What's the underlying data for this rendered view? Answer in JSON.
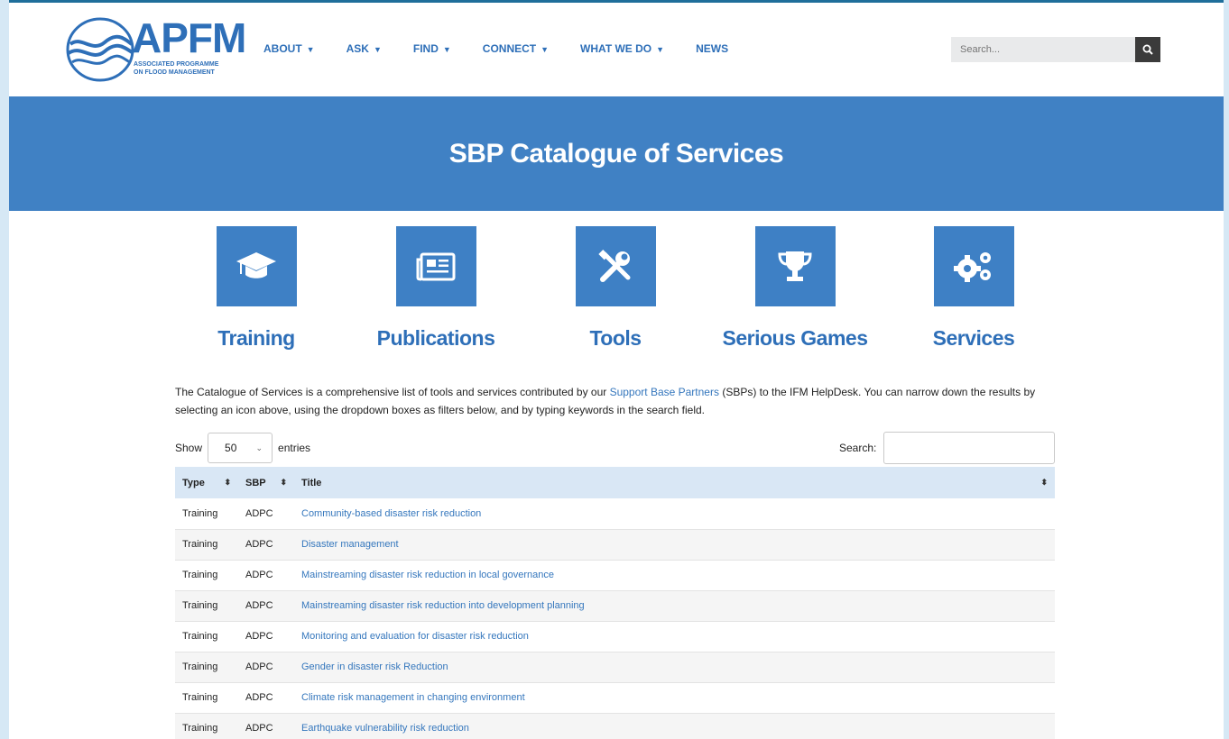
{
  "header": {
    "logo": {
      "acronym": "APFM",
      "subtitle": "ASSOCIATED PROGRAMME\nON FLOOD MANAGEMENT"
    },
    "nav": [
      {
        "label": "ABOUT",
        "dropdown": true
      },
      {
        "label": "ASK",
        "dropdown": true
      },
      {
        "label": "FIND",
        "dropdown": true
      },
      {
        "label": "CONNECT",
        "dropdown": true
      },
      {
        "label": "WHAT WE DO",
        "dropdown": true
      },
      {
        "label": "NEWS",
        "dropdown": false
      }
    ],
    "search_placeholder": "Search..."
  },
  "banner": {
    "title": "SBP Catalogue of Services"
  },
  "categories": [
    {
      "label": "Training",
      "icon": "graduation-cap-icon"
    },
    {
      "label": "Publications",
      "icon": "newspaper-icon"
    },
    {
      "label": "Tools",
      "icon": "tools-icon"
    },
    {
      "label": "Serious Games",
      "icon": "trophy-icon"
    },
    {
      "label": "Services",
      "icon": "cogs-icon"
    }
  ],
  "intro": {
    "before_link": "The Catalogue of Services is a comprehensive list of tools and services contributed by our ",
    "link_text": "Support Base Partners",
    "after_link": " (SBPs) to the IFM HelpDesk. You can narrow down the results by selecting an icon above, using the dropdown boxes as filters below, and by typing keywords in the search field."
  },
  "table_controls": {
    "show_label": "Show",
    "entries_value": "50",
    "entries_label": "entries",
    "search_label": "Search:"
  },
  "table": {
    "columns": [
      "Type",
      "SBP",
      "Title"
    ],
    "rows": [
      {
        "type": "Training",
        "sbp": "ADPC",
        "title": "Community-based disaster risk reduction"
      },
      {
        "type": "Training",
        "sbp": "ADPC",
        "title": "Disaster management"
      },
      {
        "type": "Training",
        "sbp": "ADPC",
        "title": "Mainstreaming disaster risk reduction in local governance"
      },
      {
        "type": "Training",
        "sbp": "ADPC",
        "title": "Mainstreaming disaster risk reduction into development planning"
      },
      {
        "type": "Training",
        "sbp": "ADPC",
        "title": "Monitoring and evaluation for disaster risk reduction"
      },
      {
        "type": "Training",
        "sbp": "ADPC",
        "title": "Gender in disaster risk Reduction"
      },
      {
        "type": "Training",
        "sbp": "ADPC",
        "title": "Climate risk management in changing environment"
      },
      {
        "type": "Training",
        "sbp": "ADPC",
        "title": "Earthquake vulnerability risk reduction"
      }
    ]
  },
  "colors": {
    "brand_blue": "#4081c4",
    "link_blue": "#3577bd",
    "header_row": "#d9e7f5"
  }
}
